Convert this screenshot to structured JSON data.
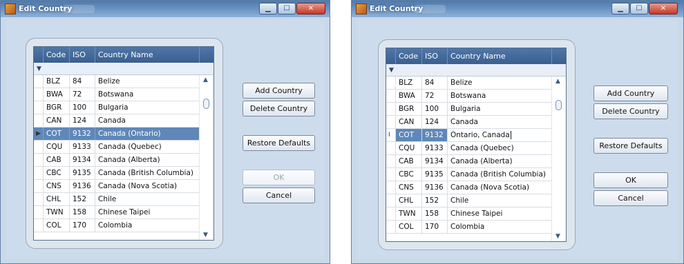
{
  "dialogs": [
    {
      "title": "Edit Country",
      "columns": {
        "code": "Code",
        "iso": "ISO",
        "name": "Country Name"
      },
      "buttons": {
        "add": "Add Country",
        "delete": "Delete Country",
        "restore": "Restore Defaults",
        "ok": "OK",
        "ok_enabled": false,
        "cancel": "Cancel"
      },
      "rows": [
        {
          "code": "BLZ",
          "iso": "84",
          "name": "Belize",
          "state": ""
        },
        {
          "code": "BWA",
          "iso": "72",
          "name": "Botswana",
          "state": ""
        },
        {
          "code": "BGR",
          "iso": "100",
          "name": "Bulgaria",
          "state": ""
        },
        {
          "code": "CAN",
          "iso": "124",
          "name": "Canada",
          "state": ""
        },
        {
          "code": "COT",
          "iso": "9132",
          "name": "Canada (Ontario)",
          "state": "selected"
        },
        {
          "code": "CQU",
          "iso": "9133",
          "name": "Canada (Quebec)",
          "state": ""
        },
        {
          "code": "CAB",
          "iso": "9134",
          "name": "Canada (Alberta)",
          "state": ""
        },
        {
          "code": "CBC",
          "iso": "9135",
          "name": "Canada (British Columbia)",
          "state": ""
        },
        {
          "code": "CNS",
          "iso": "9136",
          "name": "Canada (Nova Scotia)",
          "state": ""
        },
        {
          "code": "CHL",
          "iso": "152",
          "name": "Chile",
          "state": ""
        },
        {
          "code": "TWN",
          "iso": "158",
          "name": "Chinese Taipei",
          "state": ""
        },
        {
          "code": "COL",
          "iso": "170",
          "name": "Colombia",
          "state": ""
        }
      ]
    },
    {
      "title": "Edit Country",
      "columns": {
        "code": "Code",
        "iso": "ISO",
        "name": "Country Name"
      },
      "buttons": {
        "add": "Add Country",
        "delete": "Delete Country",
        "restore": "Restore Defaults",
        "ok": "OK",
        "ok_enabled": true,
        "cancel": "Cancel"
      },
      "rows": [
        {
          "code": "BLZ",
          "iso": "84",
          "name": "Belize",
          "state": ""
        },
        {
          "code": "BWA",
          "iso": "72",
          "name": "Botswana",
          "state": ""
        },
        {
          "code": "BGR",
          "iso": "100",
          "name": "Bulgaria",
          "state": ""
        },
        {
          "code": "CAN",
          "iso": "124",
          "name": "Canada",
          "state": ""
        },
        {
          "code": "COT",
          "iso": "9132",
          "name": "Ontario, Canada",
          "state": "editing"
        },
        {
          "code": "CQU",
          "iso": "9133",
          "name": "Canada (Quebec)",
          "state": ""
        },
        {
          "code": "CAB",
          "iso": "9134",
          "name": "Canada (Alberta)",
          "state": ""
        },
        {
          "code": "CBC",
          "iso": "9135",
          "name": "Canada (British Columbia)",
          "state": ""
        },
        {
          "code": "CNS",
          "iso": "9136",
          "name": "Canada (Nova Scotia)",
          "state": ""
        },
        {
          "code": "CHL",
          "iso": "152",
          "name": "Chile",
          "state": ""
        },
        {
          "code": "TWN",
          "iso": "158",
          "name": "Chinese Taipei",
          "state": ""
        },
        {
          "code": "COL",
          "iso": "170",
          "name": "Colombia",
          "state": ""
        }
      ]
    }
  ],
  "icons": {
    "minimize": "minimize-icon",
    "maximize": "maximize-icon",
    "close": "close-icon",
    "filter": "filter-icon",
    "selected_row": "row-pointer-icon",
    "editing_row": "text-cursor-icon",
    "scroll_up": "chevron-up-icon",
    "scroll_down": "chevron-down-icon"
  },
  "colors": {
    "selected_row": "#5f87b9",
    "header": "#4f77a8",
    "window_bg": "#c9d9ea"
  }
}
